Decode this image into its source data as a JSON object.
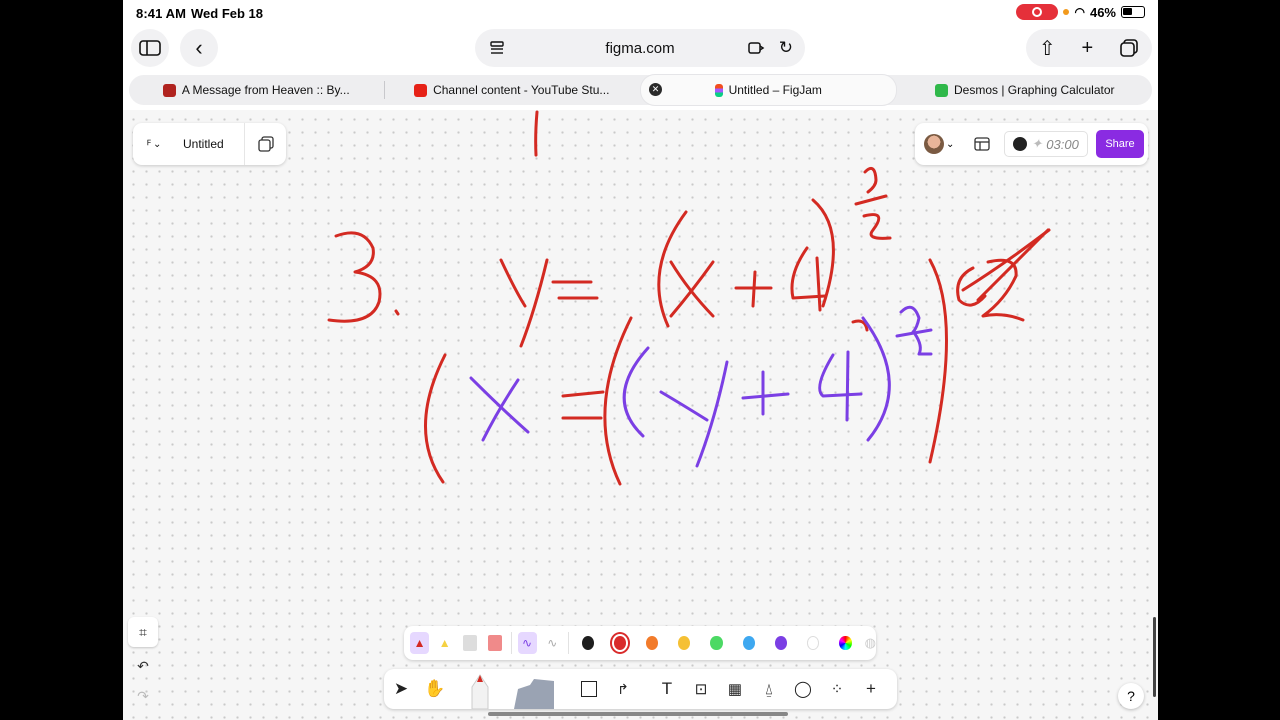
{
  "status": {
    "time": "8:41 AM",
    "date": "Wed Feb 18",
    "battery": "46%"
  },
  "browser": {
    "url": "figma.com",
    "tabs": [
      {
        "label": "A Message from Heaven :: By...",
        "fav_color": "#b0231f"
      },
      {
        "label": "Channel content - YouTube Stu...",
        "fav_color": "#e62117"
      },
      {
        "label": "Untitled – FigJam",
        "fav_color": "#a259ff"
      },
      {
        "label": "Desmos | Graphing Calculator",
        "fav_color": "#2fb84a"
      }
    ]
  },
  "figjam": {
    "file_name": "Untitled",
    "timer": "03:00",
    "share_label": "Share"
  },
  "pen_colors": [
    "#1e1e1e",
    "#d92b2b",
    "#f27b2a",
    "#f5c034",
    "#4cd964",
    "#3ea8f0",
    "#7b3fe4",
    "#ffffff"
  ],
  "icons": {
    "sidebar": "sidebar-icon",
    "back": "back-chevron-icon",
    "reader": "reader-icon",
    "reload": "reload-icon",
    "share": "share-icon",
    "new_tab": "plus-icon",
    "tabs": "tabs-icon"
  },
  "help_label": "?"
}
